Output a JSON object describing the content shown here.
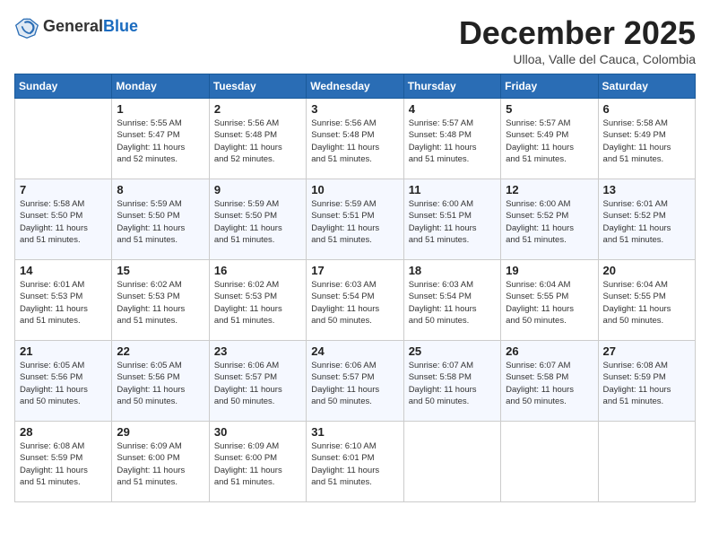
{
  "header": {
    "logo_general": "General",
    "logo_blue": "Blue",
    "month_title": "December 2025",
    "subtitle": "Ulloa, Valle del Cauca, Colombia"
  },
  "weekdays": [
    "Sunday",
    "Monday",
    "Tuesday",
    "Wednesday",
    "Thursday",
    "Friday",
    "Saturday"
  ],
  "weeks": [
    [
      {
        "day": "",
        "info": ""
      },
      {
        "day": "1",
        "info": "Sunrise: 5:55 AM\nSunset: 5:47 PM\nDaylight: 11 hours\nand 52 minutes."
      },
      {
        "day": "2",
        "info": "Sunrise: 5:56 AM\nSunset: 5:48 PM\nDaylight: 11 hours\nand 52 minutes."
      },
      {
        "day": "3",
        "info": "Sunrise: 5:56 AM\nSunset: 5:48 PM\nDaylight: 11 hours\nand 51 minutes."
      },
      {
        "day": "4",
        "info": "Sunrise: 5:57 AM\nSunset: 5:48 PM\nDaylight: 11 hours\nand 51 minutes."
      },
      {
        "day": "5",
        "info": "Sunrise: 5:57 AM\nSunset: 5:49 PM\nDaylight: 11 hours\nand 51 minutes."
      },
      {
        "day": "6",
        "info": "Sunrise: 5:58 AM\nSunset: 5:49 PM\nDaylight: 11 hours\nand 51 minutes."
      }
    ],
    [
      {
        "day": "7",
        "info": "Sunrise: 5:58 AM\nSunset: 5:50 PM\nDaylight: 11 hours\nand 51 minutes."
      },
      {
        "day": "8",
        "info": "Sunrise: 5:59 AM\nSunset: 5:50 PM\nDaylight: 11 hours\nand 51 minutes."
      },
      {
        "day": "9",
        "info": "Sunrise: 5:59 AM\nSunset: 5:50 PM\nDaylight: 11 hours\nand 51 minutes."
      },
      {
        "day": "10",
        "info": "Sunrise: 5:59 AM\nSunset: 5:51 PM\nDaylight: 11 hours\nand 51 minutes."
      },
      {
        "day": "11",
        "info": "Sunrise: 6:00 AM\nSunset: 5:51 PM\nDaylight: 11 hours\nand 51 minutes."
      },
      {
        "day": "12",
        "info": "Sunrise: 6:00 AM\nSunset: 5:52 PM\nDaylight: 11 hours\nand 51 minutes."
      },
      {
        "day": "13",
        "info": "Sunrise: 6:01 AM\nSunset: 5:52 PM\nDaylight: 11 hours\nand 51 minutes."
      }
    ],
    [
      {
        "day": "14",
        "info": "Sunrise: 6:01 AM\nSunset: 5:53 PM\nDaylight: 11 hours\nand 51 minutes."
      },
      {
        "day": "15",
        "info": "Sunrise: 6:02 AM\nSunset: 5:53 PM\nDaylight: 11 hours\nand 51 minutes."
      },
      {
        "day": "16",
        "info": "Sunrise: 6:02 AM\nSunset: 5:53 PM\nDaylight: 11 hours\nand 51 minutes."
      },
      {
        "day": "17",
        "info": "Sunrise: 6:03 AM\nSunset: 5:54 PM\nDaylight: 11 hours\nand 50 minutes."
      },
      {
        "day": "18",
        "info": "Sunrise: 6:03 AM\nSunset: 5:54 PM\nDaylight: 11 hours\nand 50 minutes."
      },
      {
        "day": "19",
        "info": "Sunrise: 6:04 AM\nSunset: 5:55 PM\nDaylight: 11 hours\nand 50 minutes."
      },
      {
        "day": "20",
        "info": "Sunrise: 6:04 AM\nSunset: 5:55 PM\nDaylight: 11 hours\nand 50 minutes."
      }
    ],
    [
      {
        "day": "21",
        "info": "Sunrise: 6:05 AM\nSunset: 5:56 PM\nDaylight: 11 hours\nand 50 minutes."
      },
      {
        "day": "22",
        "info": "Sunrise: 6:05 AM\nSunset: 5:56 PM\nDaylight: 11 hours\nand 50 minutes."
      },
      {
        "day": "23",
        "info": "Sunrise: 6:06 AM\nSunset: 5:57 PM\nDaylight: 11 hours\nand 50 minutes."
      },
      {
        "day": "24",
        "info": "Sunrise: 6:06 AM\nSunset: 5:57 PM\nDaylight: 11 hours\nand 50 minutes."
      },
      {
        "day": "25",
        "info": "Sunrise: 6:07 AM\nSunset: 5:58 PM\nDaylight: 11 hours\nand 50 minutes."
      },
      {
        "day": "26",
        "info": "Sunrise: 6:07 AM\nSunset: 5:58 PM\nDaylight: 11 hours\nand 50 minutes."
      },
      {
        "day": "27",
        "info": "Sunrise: 6:08 AM\nSunset: 5:59 PM\nDaylight: 11 hours\nand 51 minutes."
      }
    ],
    [
      {
        "day": "28",
        "info": "Sunrise: 6:08 AM\nSunset: 5:59 PM\nDaylight: 11 hours\nand 51 minutes."
      },
      {
        "day": "29",
        "info": "Sunrise: 6:09 AM\nSunset: 6:00 PM\nDaylight: 11 hours\nand 51 minutes."
      },
      {
        "day": "30",
        "info": "Sunrise: 6:09 AM\nSunset: 6:00 PM\nDaylight: 11 hours\nand 51 minutes."
      },
      {
        "day": "31",
        "info": "Sunrise: 6:10 AM\nSunset: 6:01 PM\nDaylight: 11 hours\nand 51 minutes."
      },
      {
        "day": "",
        "info": ""
      },
      {
        "day": "",
        "info": ""
      },
      {
        "day": "",
        "info": ""
      }
    ]
  ]
}
